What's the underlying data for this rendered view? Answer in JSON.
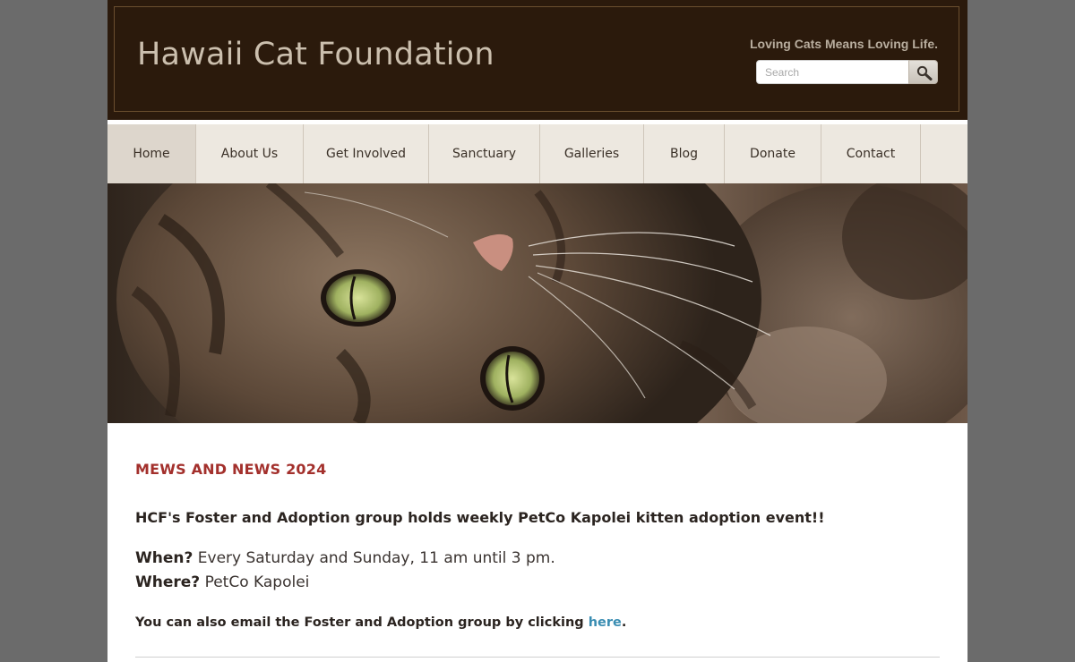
{
  "header": {
    "site_title": "Hawaii Cat Foundation",
    "tagline": "Loving Cats Means Loving Life.",
    "search_placeholder": "Search"
  },
  "nav": {
    "items": [
      {
        "label": "Home"
      },
      {
        "label": "About Us"
      },
      {
        "label": "Get Involved"
      },
      {
        "label": "Sanctuary"
      },
      {
        "label": "Galleries"
      },
      {
        "label": "Blog"
      },
      {
        "label": "Donate"
      },
      {
        "label": "Contact"
      }
    ],
    "active": "Home"
  },
  "content": {
    "heading": "MEWS AND NEWS 2024",
    "event_headline": "HCF's Foster and Adoption group holds weekly PetCo Kapolei kitten adoption event!!",
    "when_label": "When?",
    "when_value": " Every Saturday and Sunday, 11 am until 3 pm.",
    "where_label": "Where?",
    "where_value": " PetCo Kapolei",
    "email_text": "You can also email the Foster and Adoption group by clicking ",
    "email_link": "here",
    "email_end": "."
  },
  "colors": {
    "header_bg": "#2b1a0c",
    "nav_bg": "#ede8e0",
    "heading_red": "#a3302c",
    "link_blue": "#3a8db2"
  }
}
